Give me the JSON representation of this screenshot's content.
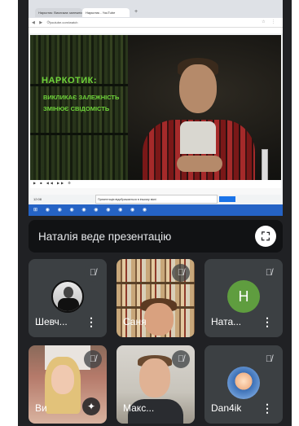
{
  "shared_screen": {
    "tabs": [
      "Наркотик: Викликає залежність",
      "Наркотик - YouTube"
    ],
    "url": "youtube.com/watch",
    "video_title_line1": "НАРКОТИК:",
    "video_title_line2": "ВИКЛИКАЄ ЗАЛЕЖНІСТЬ",
    "video_title_line3": "ЗМІНЮЄ СВІДОМІСТЬ",
    "time": "12:08",
    "notice_text": "Презентація відображається в іншому вікні"
  },
  "banner": {
    "text": "Наталія веде презентацію"
  },
  "participants": [
    {
      "name": "Шевч...",
      "muted": true,
      "avatar": "photo"
    },
    {
      "name": "Саня",
      "muted": true,
      "avatar": "camera"
    },
    {
      "name": "Ната...",
      "muted": true,
      "avatar": "letter",
      "initial": "Н"
    },
    {
      "name": "Ви",
      "muted": true,
      "avatar": "camera"
    },
    {
      "name": "Макс...",
      "muted": true,
      "avatar": "camera"
    },
    {
      "name": "Dan4ik",
      "muted": true,
      "avatar": "cartoon"
    }
  ],
  "colors": {
    "background": "#202124",
    "tile": "#3c4043",
    "accent_green": "#6fd33a",
    "avatar_green": "#5f9d3f"
  }
}
